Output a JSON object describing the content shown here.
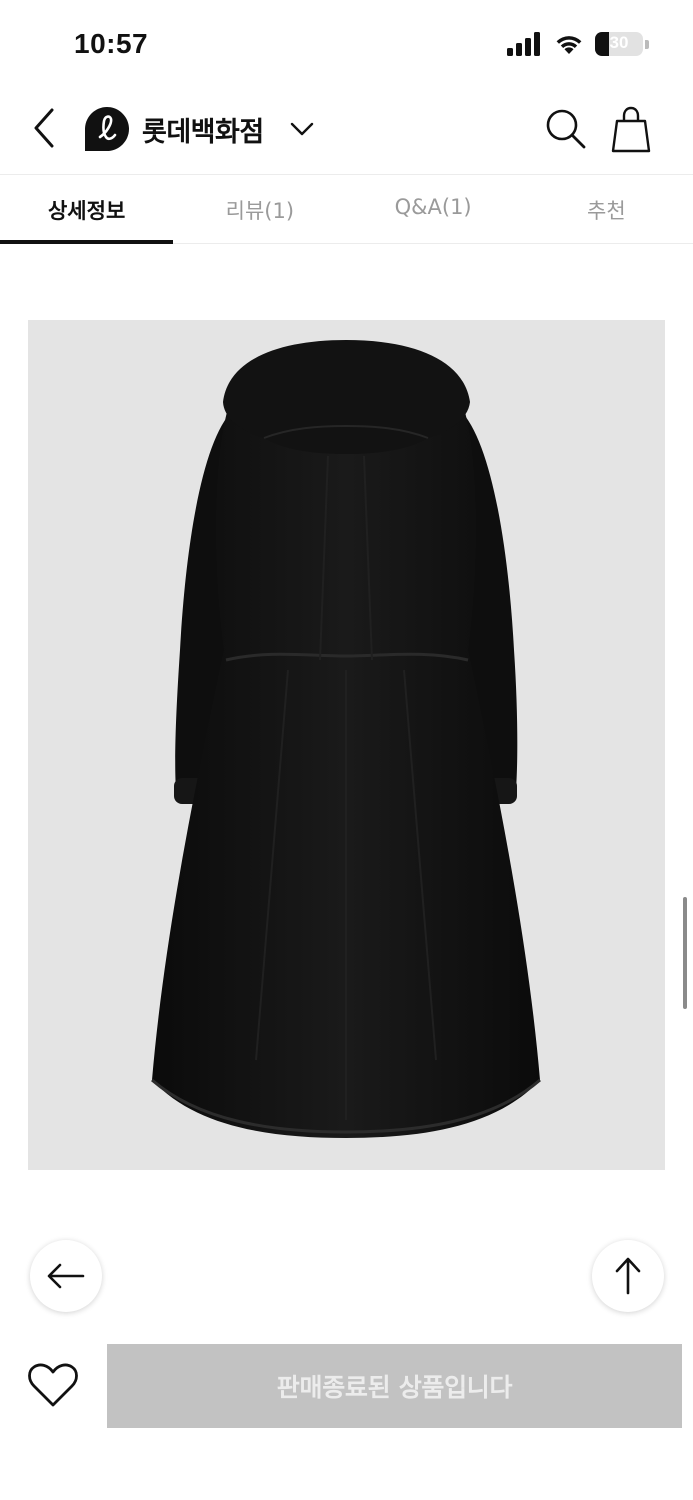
{
  "status_bar": {
    "time": "10:57",
    "battery_level": "30",
    "battery_fraction": 0.3,
    "icons": [
      "signal-icon",
      "wifi-icon",
      "battery-icon"
    ]
  },
  "header": {
    "brand_name": "롯데백화점",
    "icons": [
      "back-icon",
      "brand-logo-icon",
      "chevron-down-icon",
      "search-icon",
      "shopping-bag-icon"
    ]
  },
  "tabs": [
    {
      "label": "상세정보",
      "active": true
    },
    {
      "label": "리뷰(1)",
      "active": false
    },
    {
      "label": "Q&A(1)",
      "active": false
    },
    {
      "label": "추천",
      "active": false
    }
  ],
  "product_image": {
    "subject": "black long hooded coat back view",
    "background_color": "#e4e4e4"
  },
  "floating_buttons": {
    "icons": [
      "arrow-left-icon",
      "arrow-up-icon"
    ]
  },
  "bottom_bar": {
    "soldout_label": "판매종료된 상품입니다",
    "icons": [
      "heart-icon"
    ]
  },
  "colors": {
    "accent": "#111111",
    "inactive_tab": "#9a9a9a",
    "soldout_button": "#c2c2c2",
    "soldout_text": "#ececec"
  }
}
